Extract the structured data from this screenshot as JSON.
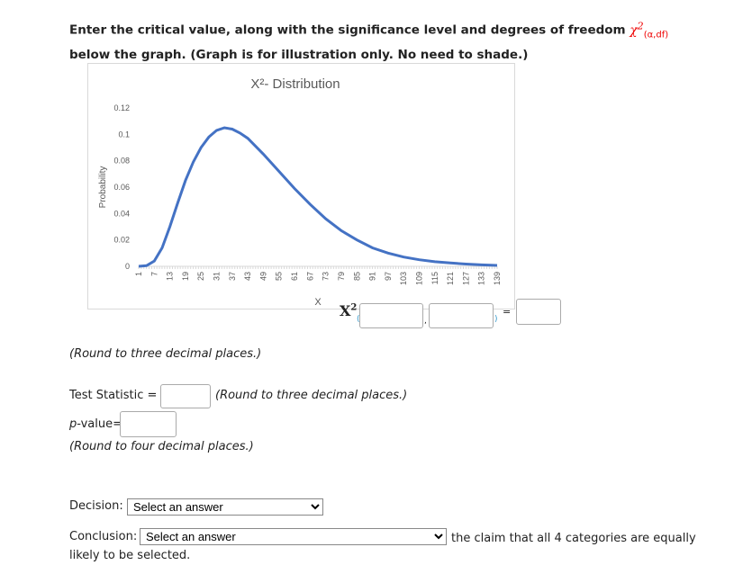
{
  "question": {
    "text_before": "Enter the critical value, along with the significance level and degrees of freedom",
    "chi_symbol": "χ",
    "chi_sup": "2",
    "chi_sub": "(α,df)",
    "text_after": "below the graph. (Graph is for illustration only. No need to shade.)"
  },
  "chart_data": {
    "type": "line",
    "title": "X²- Distribution",
    "xlabel": "X",
    "ylabel": "Probability",
    "x_tick_labels": [
      "1",
      "7",
      "13",
      "19",
      "25",
      "31",
      "37",
      "43",
      "49",
      "55",
      "61",
      "67",
      "73",
      "79",
      "85",
      "91",
      "97",
      "103",
      "109",
      "115",
      "121",
      "127",
      "133",
      "139"
    ],
    "y_tick_labels": [
      "0",
      "0.02",
      "0.04",
      "0.06",
      "0.08",
      "0.1",
      "0.12"
    ],
    "xlim": [
      1,
      139
    ],
    "ylim": [
      0,
      0.12
    ],
    "grid": false,
    "line_color": "#4472c4",
    "x": [
      1,
      4,
      7,
      10,
      13,
      16,
      19,
      22,
      25,
      28,
      31,
      34,
      37,
      40,
      43,
      49,
      55,
      61,
      67,
      73,
      79,
      85,
      91,
      97,
      103,
      109,
      115,
      121,
      127,
      133,
      139
    ],
    "y": [
      0,
      0.0005,
      0.004,
      0.014,
      0.03,
      0.048,
      0.065,
      0.079,
      0.09,
      0.098,
      0.103,
      0.105,
      0.104,
      0.101,
      0.097,
      0.085,
      0.072,
      0.059,
      0.047,
      0.036,
      0.027,
      0.02,
      0.014,
      0.01,
      0.007,
      0.005,
      0.0035,
      0.0025,
      0.0017,
      0.0011,
      0.0007
    ]
  },
  "critical": {
    "symbol": "X",
    "sup": "2",
    "open": "(",
    "comma": ",",
    "close": ")",
    "equals": "="
  },
  "round3": "(Round to three decimal places.)",
  "test_statistic": {
    "label": "Test Statistic =",
    "hint": "(Round to three decimal places.)"
  },
  "pvalue": {
    "label_p": "p",
    "label_rest": "-value=",
    "hint": "(Round to four decimal places.)"
  },
  "decision": {
    "label": "Decision:",
    "selected": "Select an answer"
  },
  "conclusion": {
    "label": "Conclusion:",
    "selected": "Select an answer",
    "after": "the claim that all 4 categories are equally likely to be selected."
  }
}
